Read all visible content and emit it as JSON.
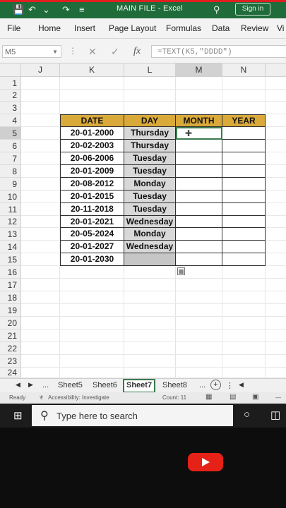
{
  "titlebar": {
    "file_name": "MAIN FILE",
    "app": "Excel",
    "separator": " - ",
    "sign_in": "Sign in"
  },
  "ribbon": {
    "tabs": [
      "File",
      "Home",
      "Insert",
      "Page Layout",
      "Formulas",
      "Data",
      "Review",
      "Vi"
    ]
  },
  "formula_bar": {
    "name_box": "M5",
    "fx": "fx",
    "formula": "=TEXT(K5,\"DDDD\")"
  },
  "columns": [
    "J",
    "K",
    "L",
    "M",
    "N"
  ],
  "rows": [
    "1",
    "2",
    "3",
    "4",
    "5",
    "6",
    "7",
    "8",
    "9",
    "10",
    "11",
    "12",
    "13",
    "14",
    "15",
    "16",
    "17",
    "18",
    "19",
    "20",
    "21",
    "22",
    "23",
    "24"
  ],
  "table": {
    "headers": [
      "DATE",
      "DAY",
      "MONTH",
      "YEAR"
    ],
    "rows": [
      {
        "date": "20-01-2000",
        "day": "Thursday"
      },
      {
        "date": "20-02-2003",
        "day": "Thursday"
      },
      {
        "date": "20-06-2006",
        "day": "Tuesday"
      },
      {
        "date": "20-01-2009",
        "day": "Tuesday"
      },
      {
        "date": "20-08-2012",
        "day": "Monday"
      },
      {
        "date": "20-01-2015",
        "day": "Tuesday"
      },
      {
        "date": "20-11-2018",
        "day": "Tuesday"
      },
      {
        "date": "20-01-2021",
        "day": "Wednesday"
      },
      {
        "date": "20-05-2024",
        "day": "Monday"
      },
      {
        "date": "20-01-2027",
        "day": "Wednesday"
      },
      {
        "date": "20-01-2030",
        "day": ""
      }
    ]
  },
  "sheets": {
    "tabs": [
      "Sheet5",
      "Sheet6",
      "Sheet7",
      "Sheet8"
    ],
    "active": "Sheet7",
    "ellipsis": "..."
  },
  "status": {
    "ready": "Ready",
    "accessibility": "Accessibility: Investigate",
    "count": "Count: 11"
  },
  "taskbar": {
    "search_placeholder": "Type here to search"
  }
}
